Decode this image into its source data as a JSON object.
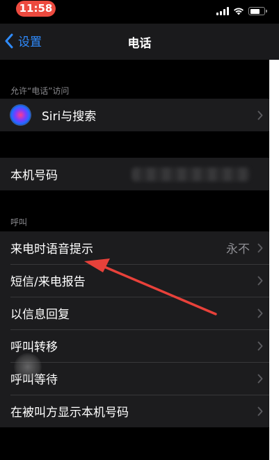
{
  "status_bar": {
    "time": "11:58"
  },
  "nav": {
    "back_label": "设置",
    "title": "电话"
  },
  "sections": {
    "allow_access_header": "允许“电话”访问",
    "siri_label": "Siri与搜索",
    "my_number_label": "本机号码",
    "calls_header": "呼叫",
    "calls_items": [
      {
        "label": "来电时语音提示",
        "value": "永不"
      },
      {
        "label": "短信/来电报告"
      },
      {
        "label": "以信息回复"
      },
      {
        "label": "呼叫转移"
      },
      {
        "label": "呼叫等待"
      },
      {
        "label": "在被叫方显示本机号码"
      }
    ]
  },
  "icons": {
    "back": "chevron-left-icon",
    "row_chevron": "chevron-right-icon",
    "siri": "siri-icon",
    "signal": "cellular-signal-icon",
    "wifi": "wifi-icon",
    "battery": "battery-icon"
  },
  "colors": {
    "accent": "#2f8cff",
    "time_pill": "#ec4a3f",
    "annotation_arrow": "#e8413a",
    "row_background": "#1c1c1e",
    "page_background": "#000000"
  }
}
